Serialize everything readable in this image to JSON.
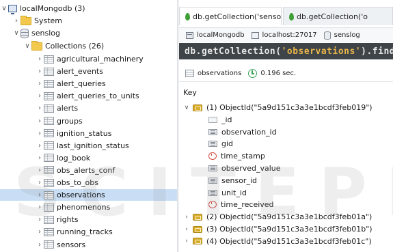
{
  "tree": {
    "connection": "localMongodb (3)",
    "system": "System",
    "database": "senslog",
    "collections_folder": "Collections (26)",
    "collections": [
      "agricultural_machinery",
      "alert_events",
      "alert_queries",
      "alert_queries_to_units",
      "alerts",
      "groups",
      "ignition_status",
      "last_ignition_status",
      "log_book",
      "obs_alerts_conf",
      "obs_to_obs",
      "observations",
      "phenomenons",
      "rights",
      "running_tracks",
      "sensors"
    ],
    "selected_collection": "observations"
  },
  "tabs": [
    {
      "label": "db.getCollection('sensors').find(...",
      "close": "×"
    },
    {
      "label": "db.getCollection('o"
    }
  ],
  "connection_bar": {
    "connection": "localMongodb",
    "server": "localhost:27017",
    "database": "senslog"
  },
  "query": {
    "prefix": "db.getCollection(",
    "collection": "'observations'",
    "suffix": ").find("
  },
  "result": {
    "collection": "observations",
    "time": "0.196 sec."
  },
  "results_view": {
    "key_header": "Key",
    "documents": [
      {
        "label": "(1) ObjectId(\"5a9d151c3a3e1bcdf3feb019\")",
        "expanded": true,
        "fields": [
          {
            "name": "_id",
            "icon": "string-field-icon"
          },
          {
            "name": "observation_id",
            "icon": "number-field-icon"
          },
          {
            "name": "gid",
            "icon": "number-field-icon"
          },
          {
            "name": "time_stamp",
            "icon": "date-field-icon"
          },
          {
            "name": "observed_value",
            "icon": "number-field-icon"
          },
          {
            "name": "sensor_id",
            "icon": "number-field-icon"
          },
          {
            "name": "unit_id",
            "icon": "number-field-icon"
          },
          {
            "name": "time_received",
            "icon": "date-field-icon"
          }
        ]
      },
      {
        "label": "(2) ObjectId(\"5a9d151c3a3e1bcdf3feb01a\")",
        "expanded": false
      },
      {
        "label": "(3) ObjectId(\"5a9d151c3a3e1bcdf3feb01b\")",
        "expanded": false
      },
      {
        "label": "(4) ObjectId(\"5a9d151c3a3e1bcdf3feb01c\")",
        "expanded": false
      }
    ]
  },
  "watermark": "SCITEPRESS",
  "colors": {
    "selection": "#c9def5",
    "query_background": "#3f4448",
    "query_string": "#e7b54a",
    "leaf_green": "#3fa037"
  }
}
